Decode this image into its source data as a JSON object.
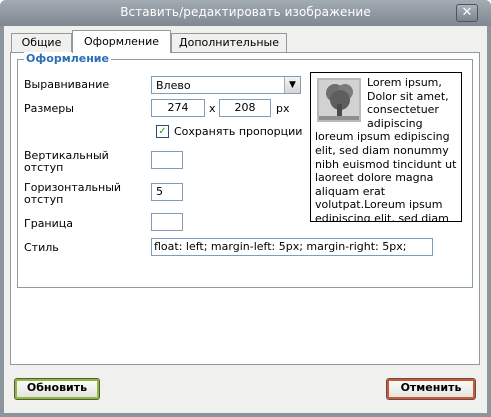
{
  "window": {
    "title": "Вставить/редактировать изображение",
    "close_symbol": "✕"
  },
  "tabs": [
    {
      "label": "Общие",
      "active": false
    },
    {
      "label": "Оформление",
      "active": true
    },
    {
      "label": "Дополнительные",
      "active": false
    }
  ],
  "appearance": {
    "legend": "Оформление",
    "alignment": {
      "label": "Выравнивание",
      "value": "Влево"
    },
    "dimensions": {
      "label": "Размеры",
      "width": "274",
      "separator": "x",
      "height": "208",
      "unit": "px"
    },
    "constrain": {
      "label": "Сохранять пропорции",
      "checked": true
    },
    "vspace": {
      "label_line1": "Вертикальный",
      "label_line2": "отступ",
      "value": ""
    },
    "hspace": {
      "label_line1": "Горизонтальный",
      "label_line2": "отступ",
      "value": "5"
    },
    "border": {
      "label": "Граница",
      "value": ""
    },
    "style": {
      "label": "Стиль",
      "value": "float: left; margin-left: 5px; margin-right: 5px;"
    },
    "preview_text": "Lorem ipsum, Dolor sit amet, consectetuer adipiscing loreum ipsum edipiscing elit, sed diam nonummy nibh euismod tincidunt ut laoreet dolore magna aliquam erat volutpat.Loreum ipsum edipiscing elit, sed diam nonummy nibh euismod"
  },
  "buttons": {
    "update": "Обновить",
    "cancel": "Отменить"
  }
}
